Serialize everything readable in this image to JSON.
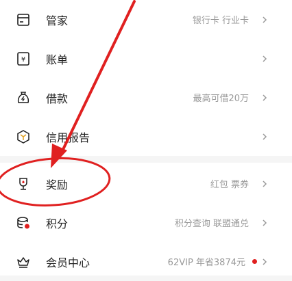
{
  "menu": {
    "items": [
      {
        "label": "管家",
        "hint": "银行卡 行业卡",
        "icon": "card-manager-icon"
      },
      {
        "label": "账单",
        "hint": "",
        "icon": "bill-icon"
      },
      {
        "label": "借款",
        "hint": "最高可借20万",
        "icon": "loan-bag-icon"
      },
      {
        "label": "信用报告",
        "hint": "",
        "icon": "credit-report-icon"
      },
      {
        "label": "奖励",
        "hint": "红包 票券",
        "icon": "trophy-icon"
      },
      {
        "label": "积分",
        "hint": "积分查询 联盟通兑",
        "icon": "points-coins-icon"
      },
      {
        "label": "会员中心",
        "hint": "62VIP 年省3874元",
        "icon": "crown-icon",
        "badge_color": "#e02020"
      }
    ]
  },
  "colors": {
    "annotation": "#e02020",
    "icon": "#1e1e1e",
    "hint_text": "#9a9a9a",
    "separator_bg": "#f5f5f5"
  }
}
